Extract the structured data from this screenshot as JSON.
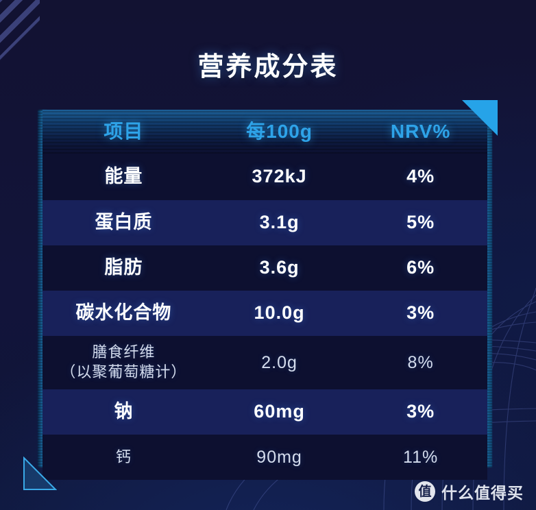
{
  "title": "营养成分表",
  "table": {
    "header": {
      "item": "项目",
      "per100g": "每100g",
      "nrv": "NRV%"
    },
    "rows": [
      {
        "item": "能量",
        "item2": "",
        "amount": "372kJ",
        "nrv": "4%",
        "style": "dark",
        "emphasis": "bold"
      },
      {
        "item": "蛋白质",
        "item2": "",
        "amount": "3.1g",
        "nrv": "5%",
        "style": "light",
        "emphasis": "bold"
      },
      {
        "item": "脂肪",
        "item2": "",
        "amount": "3.6g",
        "nrv": "6%",
        "style": "dark",
        "emphasis": "bold"
      },
      {
        "item": "碳水化合物",
        "item2": "",
        "amount": "10.0g",
        "nrv": "3%",
        "style": "light",
        "emphasis": "bold"
      },
      {
        "item": "膳食纤维",
        "item2": "（以聚葡萄糖计）",
        "amount": "2.0g",
        "nrv": "8%",
        "style": "dark",
        "emphasis": "thin"
      },
      {
        "item": "钠",
        "item2": "",
        "amount": "60mg",
        "nrv": "3%",
        "style": "light",
        "emphasis": "bold"
      },
      {
        "item": "钙",
        "item2": "",
        "amount": "90mg",
        "nrv": "11%",
        "style": "dark",
        "emphasis": "thin"
      }
    ]
  },
  "watermark": {
    "badge": "值",
    "text": "什么值得买"
  },
  "colors": {
    "page_background": "#131336",
    "row_dark": "#0d1030",
    "row_light": "#18215a",
    "header_text": "#2ea3e8",
    "accent_triangle": "#26a3e8",
    "body_text": "#ffffff",
    "stripe": "#3b4179"
  }
}
